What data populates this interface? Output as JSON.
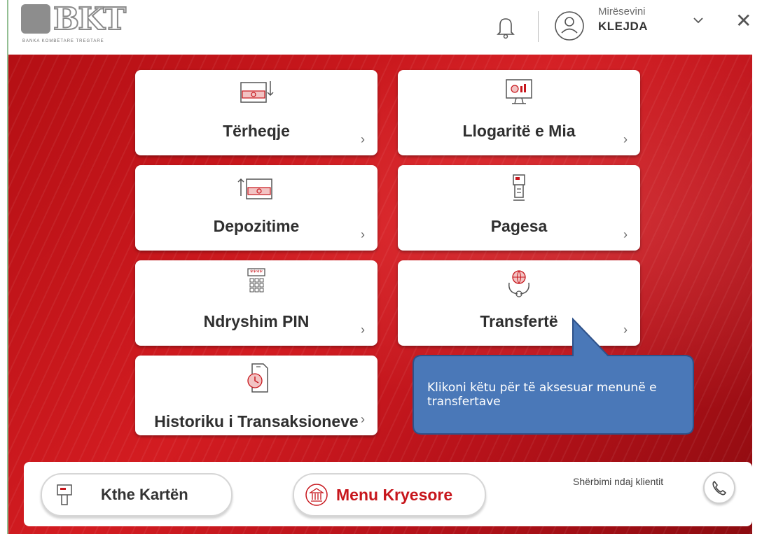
{
  "header": {
    "logo_text": "BKT",
    "logo_subtitle": "BANKA KOMBËTARE TREGTARE",
    "welcome": "Mirësevini",
    "username": "KLEJDA",
    "close": "✕"
  },
  "tiles": [
    {
      "label": "Tërheqje",
      "arrow": "›"
    },
    {
      "label": "Llogaritë e Mia",
      "arrow": "›"
    },
    {
      "label": "Depozitime",
      "arrow": "›"
    },
    {
      "label": "Pagesa",
      "arrow": "›"
    },
    {
      "label": "Ndryshim PIN",
      "arrow": "›"
    },
    {
      "label": "Transfertë",
      "arrow": "›"
    },
    {
      "label": "Historiku i Transaksioneve",
      "arrow": "›"
    }
  ],
  "callout": {
    "text": "Klikoni këtu për të aksesuar menunë e transfertave"
  },
  "bottom": {
    "return_card": "Kthe Kartën",
    "main_menu": "Menu Kryesore",
    "customer_service": "Shërbimi ndaj klientit"
  },
  "colors": {
    "brand_red": "#c7161c",
    "callout_blue": "#4a78b8",
    "callout_border": "#2e5189"
  }
}
